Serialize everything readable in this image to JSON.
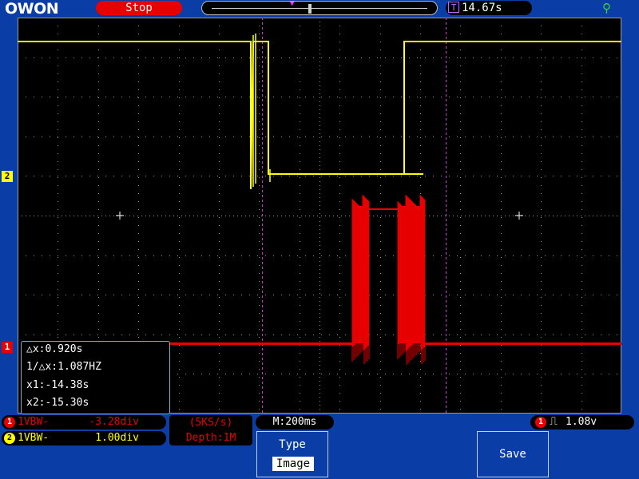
{
  "brand": {
    "logo_text": "OWON"
  },
  "header": {
    "run_status": "Stop",
    "trigger_time": "14.67s",
    "trigger_time_icon": "T",
    "usb_icon": "usb-icon"
  },
  "screen": {
    "channel_markers": {
      "ch2": "2",
      "ch1": "1"
    }
  },
  "cursor_measure": {
    "delta_x": "△x:0.920s",
    "inv_delta_x": "1/△x:1.087HZ",
    "x1": "x1:-14.38s",
    "x2": "x2:-15.30s"
  },
  "channels": {
    "ch1": {
      "badge": "1",
      "label": "1VBW-",
      "value": "-3.28div",
      "color": "#e60000"
    },
    "ch2": {
      "badge": "2",
      "label": "1VBW-",
      "value": "1.00div",
      "color": "#ffff00"
    }
  },
  "acquisition": {
    "sample_rate": "(5KS/s)",
    "depth": "Depth:1M"
  },
  "timebase": {
    "label": "M:200ms"
  },
  "trigger": {
    "badge": "1",
    "edge_icon": "rising-edge-icon",
    "level": "1.08v"
  },
  "softkeys": {
    "type": {
      "label": "Type",
      "value": "Image"
    },
    "save": {
      "label": "Save"
    }
  },
  "colors": {
    "background": "#0a3ea6",
    "screen": "#000000",
    "ch1": "#e60000",
    "ch2": "#ffff00",
    "cursor": "#cc33cc",
    "grid": "#9a9a9a"
  }
}
